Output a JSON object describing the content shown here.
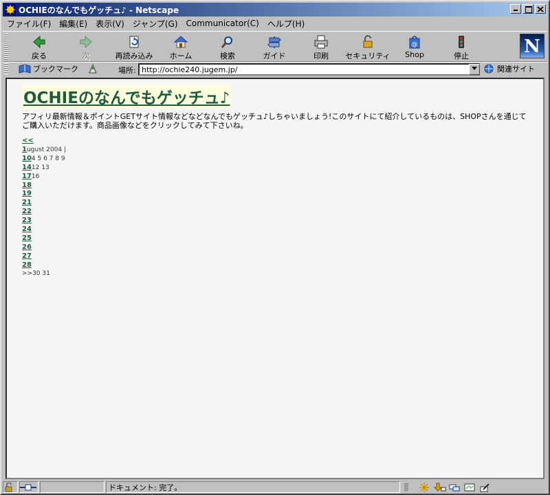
{
  "window": {
    "title": "OCHIEのなんでもゲッチュ♪ - Netscape"
  },
  "menu": [
    "ファイル(F)",
    "編集(E)",
    "表示(V)",
    "ジャンプ(G)",
    "Communicator(C)",
    "ヘルプ(H)"
  ],
  "toolbar": {
    "back": "戻る",
    "forward": "次",
    "reload": "再読み込み",
    "home": "ホーム",
    "search": "検索",
    "guide": "ガイド",
    "print": "印刷",
    "security": "セキュリティ",
    "shop": "Shop",
    "stop": "停止"
  },
  "location": {
    "bookmarks": "ブックマーク",
    "label": "場所:",
    "url": "http://ochie240.jugem.jp/",
    "related": "関連サイト"
  },
  "page": {
    "title": "OCHIEのなんでもゲッチュ♪",
    "description": "アフィリ最新情報＆ポイントGETサイト情報などなどなんでもゲッチュ♪しちゃいましょう!このサイトにて紹介しているものは、SHOPさんを通じてご購入いただけます。商品画像などをクリックしてみて下さいね。",
    "calendar": {
      "prev": "<<",
      "r1_link": "1",
      "r1_text": "ugust 2004 |",
      "r2_link": "10",
      "r2_text": "4 5 6 7 8 9",
      "r3_link": "14",
      "r3_text": "12 13",
      "r4_link": "17",
      "r4_text": "16",
      "days": [
        "18",
        "19",
        "21",
        "22",
        "23",
        "24",
        "25",
        "26",
        "27",
        "28"
      ],
      "last_text": ">>30 31"
    }
  },
  "status": {
    "text": "ドキュメント: 完了。"
  }
}
